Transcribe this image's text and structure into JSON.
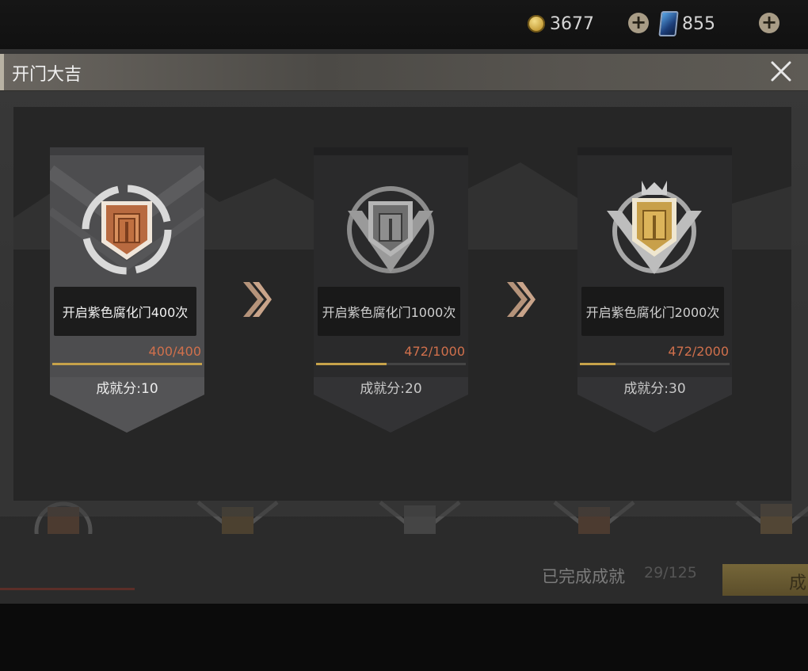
{
  "currency": {
    "gold": {
      "value": "3677",
      "icon": "gold-coin-icon"
    },
    "cards": {
      "value": "855",
      "icon": "card-icon"
    },
    "add_icon": "plus-icon"
  },
  "popup": {
    "title": "开门大吉",
    "close_icon": "close-icon"
  },
  "achievements": [
    {
      "description": "开启紫色腐化门400次",
      "progress_text": "400/400",
      "progress": 1.0,
      "score_label": "成就分:10",
      "tier": "bronze",
      "completed": true
    },
    {
      "description": "开启紫色腐化门1000次",
      "progress_text": "472/1000",
      "progress": 0.472,
      "score_label": "成就分:20",
      "tier": "silver",
      "completed": false
    },
    {
      "description": "开启紫色腐化门2000次",
      "progress_text": "472/2000",
      "progress": 0.236,
      "score_label": "成就分:30",
      "tier": "gold",
      "completed": false
    }
  ],
  "background": {
    "completed_label": "已完成成就",
    "completed_count": "29/125",
    "button_label": "成"
  },
  "colors": {
    "progress_text": "#d0704c",
    "progress_fill": "#c6a24a",
    "bronze": "#c0764a",
    "silver": "#9a9a9a",
    "gold": "#c8a04a"
  }
}
